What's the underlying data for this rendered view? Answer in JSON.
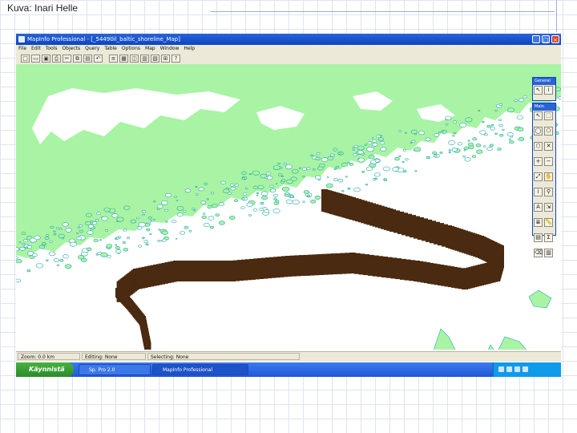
{
  "slide": {
    "caption": "Kuva: Inari Helle"
  },
  "window": {
    "title": "MapInfo Professional - [_54490il_baltic_shoreline_Map]",
    "min_label": "_",
    "max_label": "□",
    "close_label": "×"
  },
  "menu": [
    "File",
    "Edit",
    "Tools",
    "Objects",
    "Query",
    "Table",
    "Options",
    "Map",
    "Window",
    "Help"
  ],
  "toolbar_icons": [
    "new-icon",
    "open-icon",
    "save-icon",
    "print-icon",
    "cut-icon",
    "copy-icon",
    "paste-icon",
    "undo-icon",
    "layer-icon",
    "browser-icon",
    "map-icon",
    "graph-icon",
    "layout-icon",
    "redistrict-icon",
    "help-icon"
  ],
  "palettes": {
    "general": {
      "title": "General",
      "icons": [
        "select-icon",
        "info-icon"
      ]
    },
    "main": {
      "title": "Main",
      "icons": [
        "arrow-icon",
        "marquee-icon",
        "radius-icon",
        "polygon-select-icon",
        "boundary-select-icon",
        "unselect-icon",
        "zoom-in-icon",
        "zoom-out-icon",
        "change-view-icon",
        "grabber-icon",
        "info-tool-icon",
        "hotlink-icon",
        "label-icon",
        "drag-window-icon",
        "layer-control-icon",
        "ruler-icon",
        "legend-icon",
        "stats-icon",
        "clear-icon",
        "legend-tool-icon"
      ]
    }
  },
  "status": {
    "zoom": "Zoom: 0.0 km",
    "editing": "Editing: None",
    "selecting": "Selecting: None"
  },
  "taskbar": {
    "start": "Käynnistä",
    "tasks": [
      "Sp. Pro 2.0",
      "MapInfo Professional"
    ]
  },
  "colors": {
    "land": "#a8f4a4",
    "coast": "#2aa7a9",
    "oil": "#4a2a10",
    "sea": "#ffffff"
  }
}
